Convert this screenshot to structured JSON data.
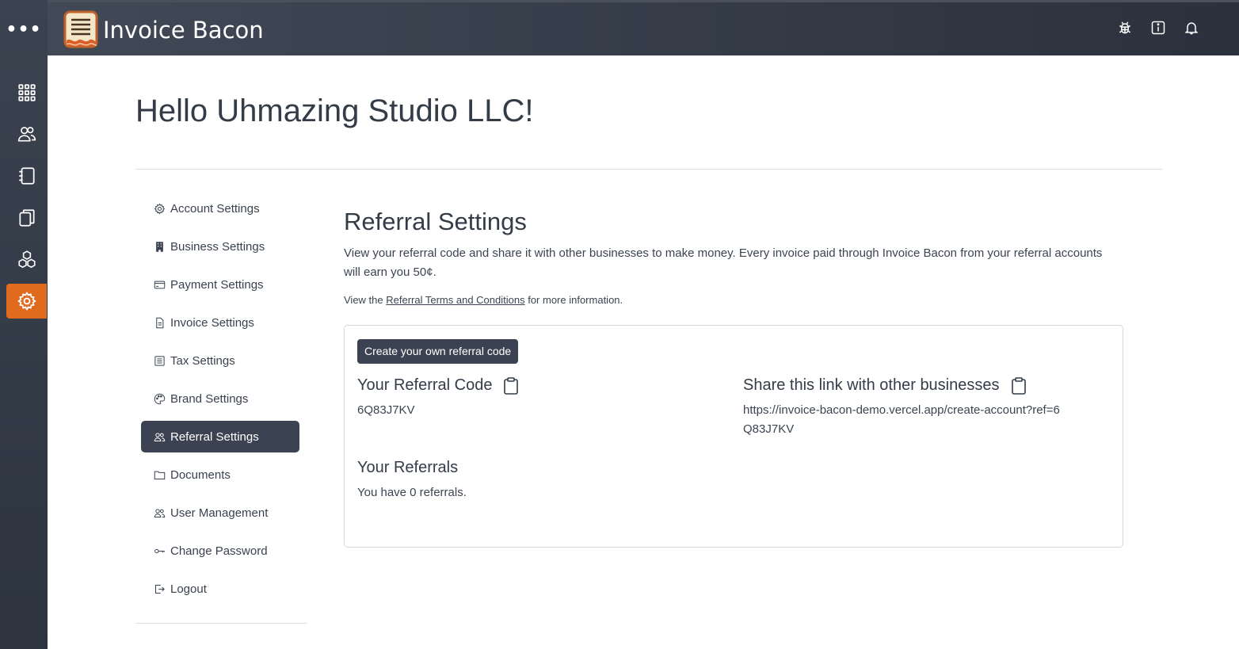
{
  "app": {
    "name": "Invoice Bacon"
  },
  "rail": {
    "menu_icon": "more-dots-icon",
    "items": [
      {
        "icon": "grid-icon",
        "active": false
      },
      {
        "icon": "users-icon",
        "active": false
      },
      {
        "icon": "notebook-icon",
        "active": false
      },
      {
        "icon": "copy-icon",
        "active": false
      },
      {
        "icon": "boxes-icon",
        "active": false
      },
      {
        "icon": "gear-icon",
        "active": true
      }
    ],
    "accent": "#e06b1f"
  },
  "header": {
    "icons": [
      "bug-icon",
      "info-icon",
      "bell-icon"
    ]
  },
  "page": {
    "greeting": "Hello Uhmazing Studio LLC!"
  },
  "nav": {
    "items": [
      {
        "label": "Account Settings",
        "icon": "gear-icon"
      },
      {
        "label": "Business Settings",
        "icon": "building-icon"
      },
      {
        "label": "Payment Settings",
        "icon": "credit-card-icon"
      },
      {
        "label": "Invoice Settings",
        "icon": "document-icon"
      },
      {
        "label": "Tax Settings",
        "icon": "ledger-icon"
      },
      {
        "label": "Brand Settings",
        "icon": "palette-icon"
      },
      {
        "label": "Referral Settings",
        "icon": "people-icon",
        "active": true
      },
      {
        "label": "Documents",
        "icon": "folder-icon"
      },
      {
        "label": "User Management",
        "icon": "people-icon"
      },
      {
        "label": "Change Password",
        "icon": "key-icon"
      },
      {
        "label": "Logout",
        "icon": "logout-icon"
      }
    ]
  },
  "referral": {
    "title": "Referral Settings",
    "description": "View your referral code and share it with other businesses to make money. Every invoice paid through Invoice Bacon from your referral accounts will earn you 50¢.",
    "terms_prefix": "View the ",
    "terms_link": "Referral Terms and Conditions",
    "terms_suffix": " for more information.",
    "create_button": "Create your own referral code",
    "code_heading": "Your Referral Code",
    "code_value": "6Q83J7KV",
    "share_heading": "Share this link with other businesses",
    "share_link": "https://invoice-bacon-demo.vercel.app/create-account?ref=6Q83J7KV",
    "referrals_heading": "Your Referrals",
    "referrals_text": "You have 0 referrals."
  }
}
